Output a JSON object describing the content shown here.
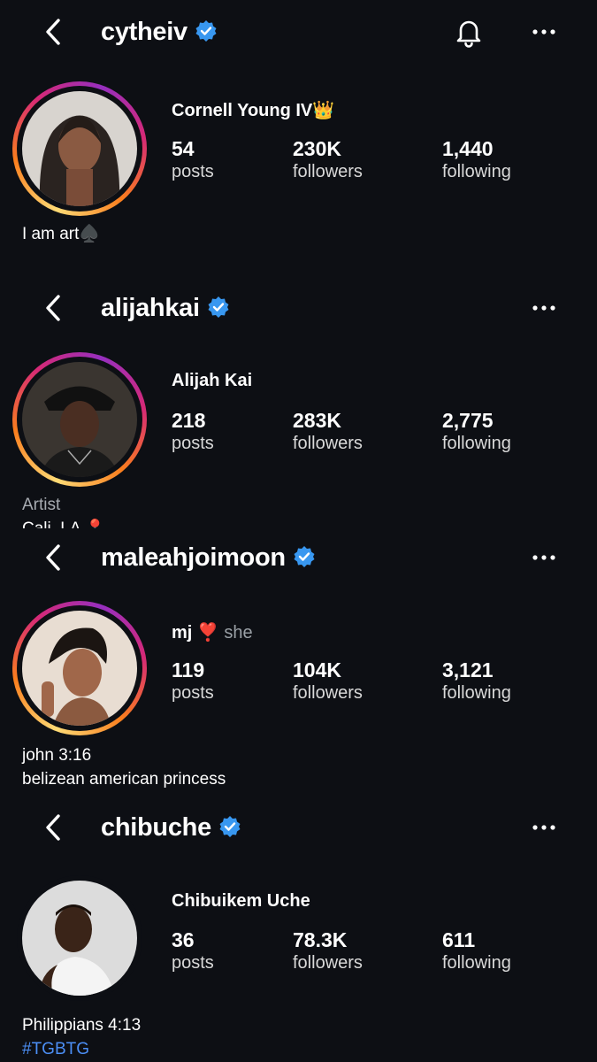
{
  "profiles": [
    {
      "username": "cytheiv",
      "full_name": "Cornell Young IV👑",
      "pronouns": "",
      "posts": "54",
      "posts_label": "posts",
      "followers": "230K",
      "followers_label": "followers",
      "following": "1,440",
      "following_label": "following",
      "bio": [
        "I am art♠️"
      ]
    },
    {
      "username": "alijahkai",
      "full_name": "Alijah Kai",
      "pronouns": "",
      "posts": "218",
      "posts_label": "posts",
      "followers": "283K",
      "followers_label": "followers",
      "following": "2,775",
      "following_label": "following",
      "bio": [
        "Artist",
        "Cali, LA 📍"
      ]
    },
    {
      "username": "maleahjoimoon",
      "full_name": "mj ❣️",
      "pronouns": "she",
      "posts": "119",
      "posts_label": "posts",
      "followers": "104K",
      "followers_label": "followers",
      "following": "3,121",
      "following_label": "following",
      "bio": [
        "john 3:16",
        "belizean american princess"
      ]
    },
    {
      "username": "chibuche",
      "full_name": "Chibuikem Uche",
      "pronouns": "",
      "posts": "36",
      "posts_label": "posts",
      "followers": "78.3K",
      "followers_label": "followers",
      "following": "611",
      "following_label": "following",
      "bio": [
        "Philippians 4:13",
        "#TGBTG"
      ]
    }
  ],
  "colors": {
    "background": "#0d0f14",
    "verified": "#3897f0",
    "link": "#4c8ff6"
  }
}
